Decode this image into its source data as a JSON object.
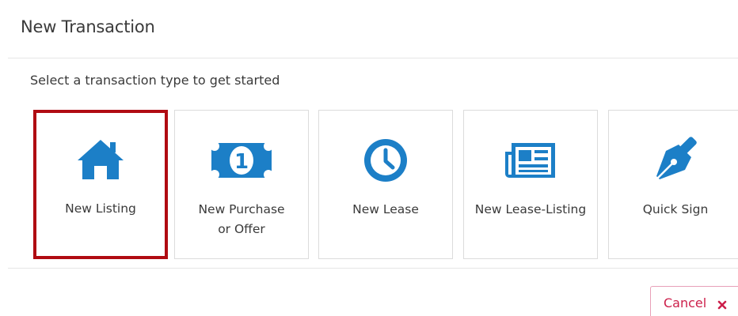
{
  "dialog": {
    "title": "New Transaction",
    "instruction": "Select a transaction type to get started"
  },
  "transaction_types": [
    {
      "label": "New Listing",
      "icon": "house-icon",
      "selected": true
    },
    {
      "label": "New Purchase\nor Offer",
      "icon": "money-icon",
      "selected": false
    },
    {
      "label": "New Lease",
      "icon": "clock-icon",
      "selected": false
    },
    {
      "label": "New Lease-Listing",
      "icon": "newspaper-icon",
      "selected": false
    },
    {
      "label": "Quick Sign",
      "icon": "pen-nib-icon",
      "selected": false
    }
  ],
  "footer": {
    "cancel_label": "Cancel",
    "cancel_icon": "close-icon"
  },
  "colors": {
    "icon_blue": "#1c7fc7",
    "selection_border": "#b00b12",
    "cancel_text": "#cc1f4a",
    "cancel_border": "#e8a0b8"
  }
}
